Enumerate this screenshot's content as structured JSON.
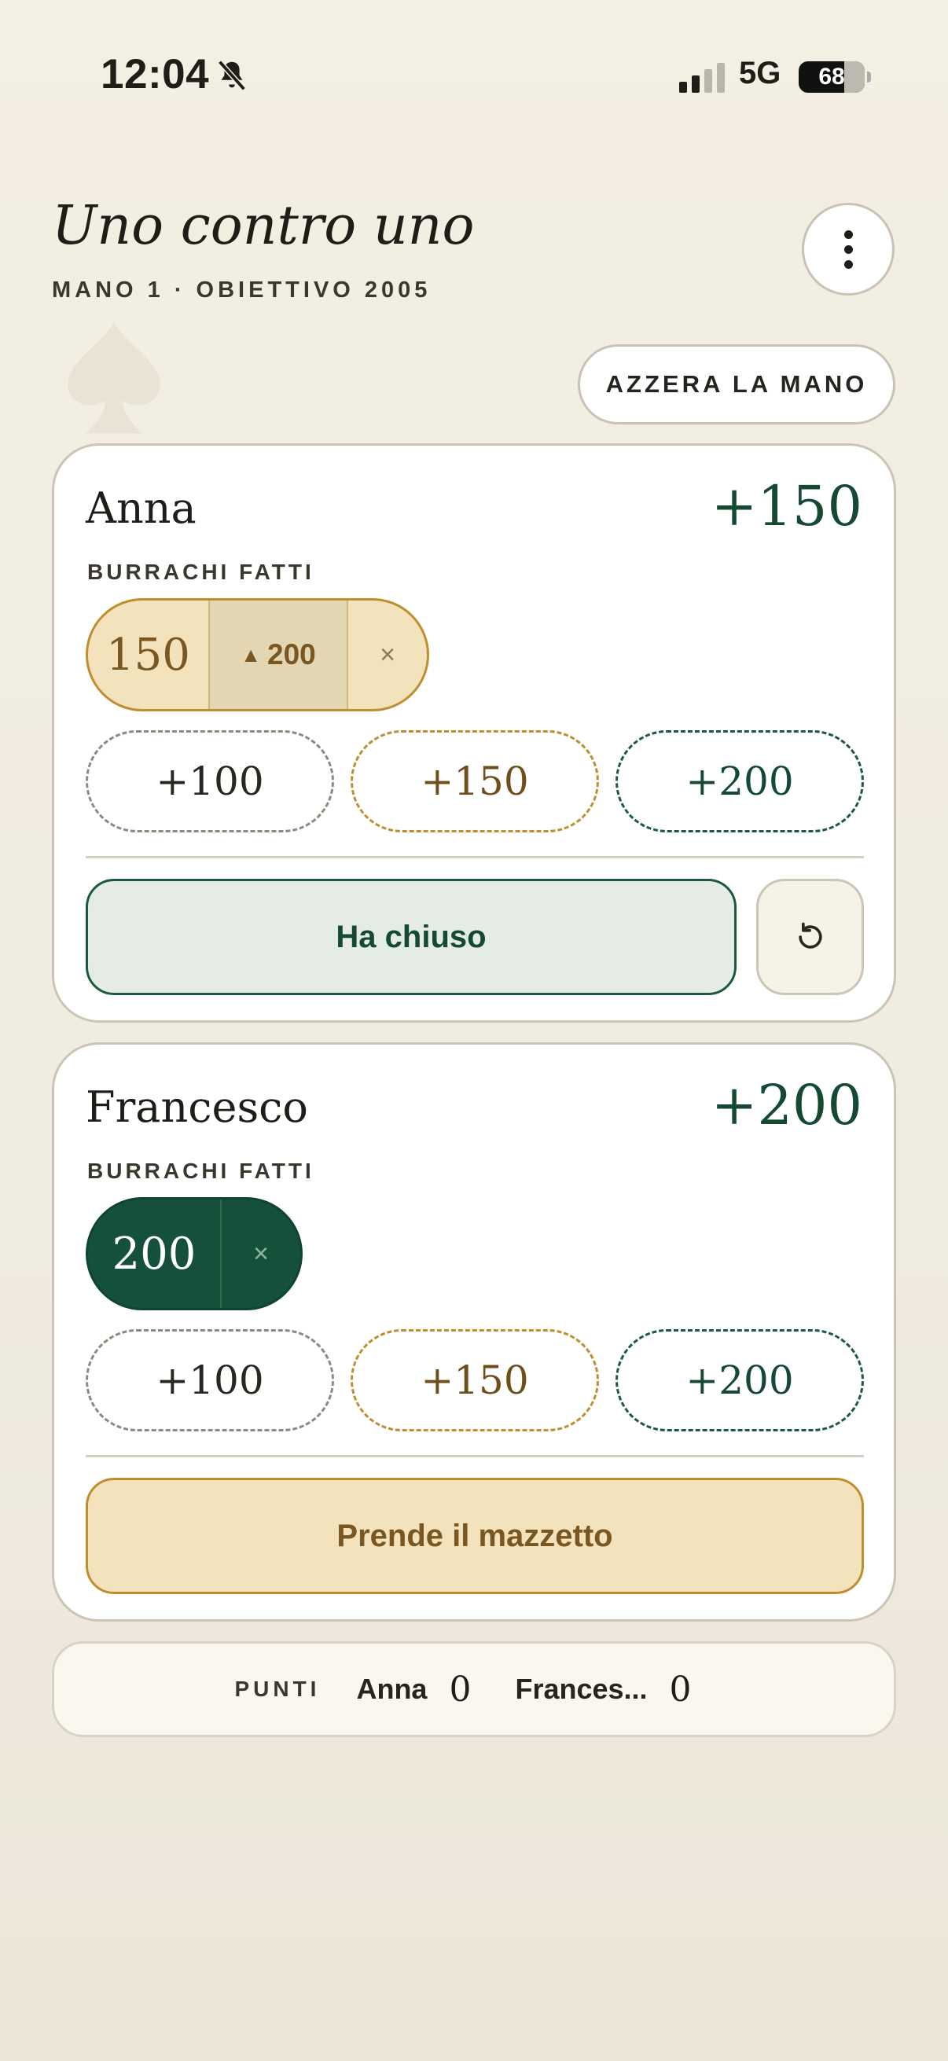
{
  "status_bar": {
    "time": "12:04",
    "network": "5G",
    "battery": "68"
  },
  "header": {
    "title": "Uno contro uno",
    "subtitle": "MANO 1 · OBIETTIVO 2005",
    "reset_hand_label": "AZZERA LA MANO"
  },
  "players": [
    {
      "name": "Anna",
      "score": "+150",
      "section_label": "BURRACHI FATTI",
      "chip": {
        "value": "150",
        "upgrade": "200",
        "remove": "×"
      },
      "add_buttons": [
        "+100",
        "+150",
        "+200"
      ],
      "action_label": "Ha chiuso"
    },
    {
      "name": "Francesco",
      "score": "+200",
      "section_label": "BURRACHI FATTI",
      "chip": {
        "value": "200",
        "remove": "×"
      },
      "add_buttons": [
        "+100",
        "+150",
        "+200"
      ],
      "action_label": "Prende il mazzetto"
    }
  ],
  "points": {
    "label": "PUNTI",
    "entries": [
      {
        "name": "Anna",
        "value": "0"
      },
      {
        "name": "Frances...",
        "value": "0"
      }
    ]
  },
  "colors": {
    "accent_green": "#154a32",
    "accent_gold": "#c08e30",
    "background": "#f4efe3"
  }
}
